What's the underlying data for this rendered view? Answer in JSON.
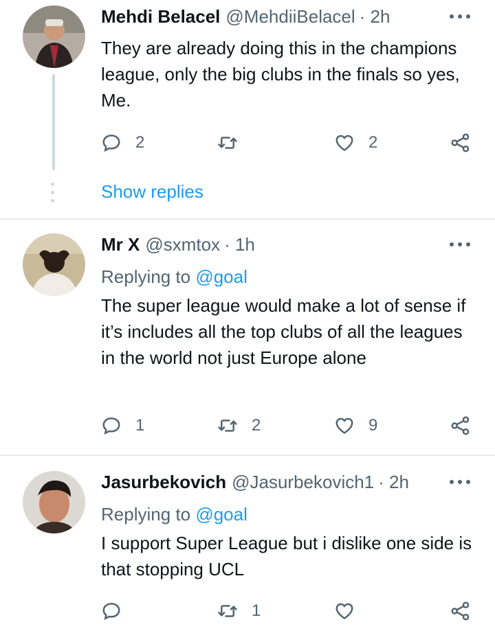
{
  "tweets": [
    {
      "name": "Mehdi Belacel",
      "handle": "@MehdiiBelacel",
      "time": "· 2h",
      "replying_label": "",
      "replying_to": "",
      "text": "They are already doing this in the champions league, only the big clubs in the finals so yes, Me.",
      "replies": "2",
      "retweets": "",
      "likes": "2",
      "show_replies": "Show replies",
      "avatar_colors": [
        "#a9a29a",
        "#2b2321"
      ]
    },
    {
      "name": "Mr X",
      "handle": "@sxmtox",
      "time": "· 1h",
      "replying_label": "Replying to",
      "replying_to": "@goal",
      "text": "The super league would make a lot of sense if it’s includes all the top clubs of all the leagues in the world not just Europe alone",
      "replies": "1",
      "retweets": "2",
      "likes": "9",
      "avatar_colors": [
        "#b7a98f",
        "#2a1f18"
      ]
    },
    {
      "name": "Jasurbekovich",
      "handle": "@Jasurbekovich1",
      "time": "· 2h",
      "replying_label": "Replying to",
      "replying_to": "@goal",
      "text": "I support Super League but i dislike one side is that stopping UCL",
      "replies": "",
      "retweets": "1",
      "likes": "",
      "avatar_colors": [
        "#d9d5cf",
        "#7a5a4a"
      ]
    }
  ],
  "icons": {
    "reply": "reply-icon",
    "retweet": "retweet-icon",
    "like": "heart-icon",
    "share": "share-icon",
    "more": "more-icon"
  },
  "colors": {
    "link": "#1d9bf0",
    "muted": "#536471",
    "divider": "#e7e9ea"
  }
}
